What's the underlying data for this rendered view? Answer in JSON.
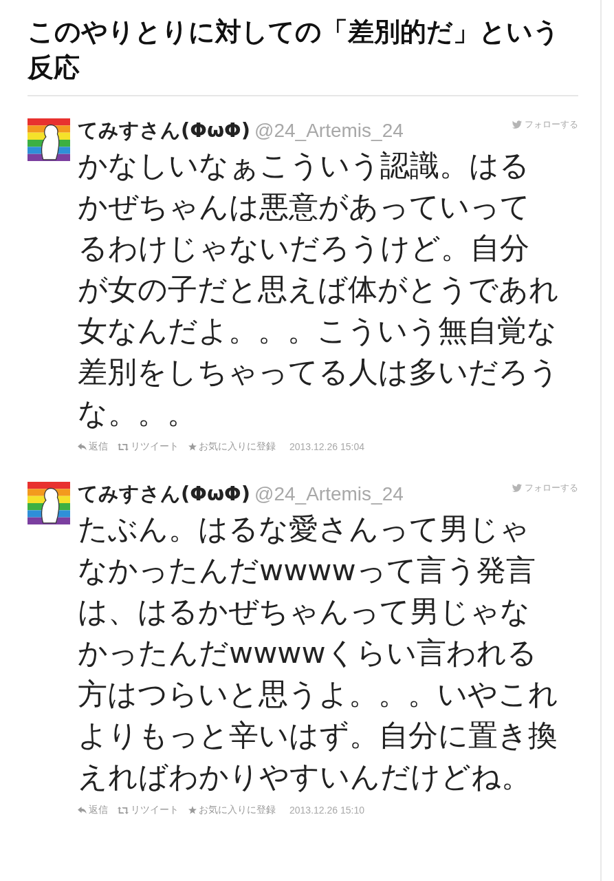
{
  "heading": "このやりとりに対しての「差別的だ」という反応",
  "tweets": [
    {
      "name": "てみすさん(ΦωΦ)",
      "handle": "@24_Artemis_24",
      "follow": "フォローする",
      "text": "かなしいなぁこういう認識。はるかぜちゃんは悪意があっていってるわけじゃないだろうけど。自分が女の子だと思えば体がとうであれ女なんだよ。。。こういう無自覚な差別をしちゃってる人は多いだろうな。。。",
      "actions": [
        "返信",
        "リツイート",
        "お気に入りに登録"
      ],
      "time": "2013.12.26 15:04"
    },
    {
      "name": "てみすさん(ΦωΦ)",
      "handle": "@24_Artemis_24",
      "follow": "フォローする",
      "text": "たぶん。はるな愛さんって男じゃなかったんだwwwwって言う発言は、はるかぜちゃんって男じゃなかったんだwwwwくらい言われる方はつらいと思うよ。。。いやこれよりもっと辛いはず。自分に置き換えればわかりやすいんだけどね。",
      "actions": [
        "返信",
        "リツイート",
        "お気に入りに登録"
      ],
      "time": "2013.12.26 15:10"
    }
  ]
}
